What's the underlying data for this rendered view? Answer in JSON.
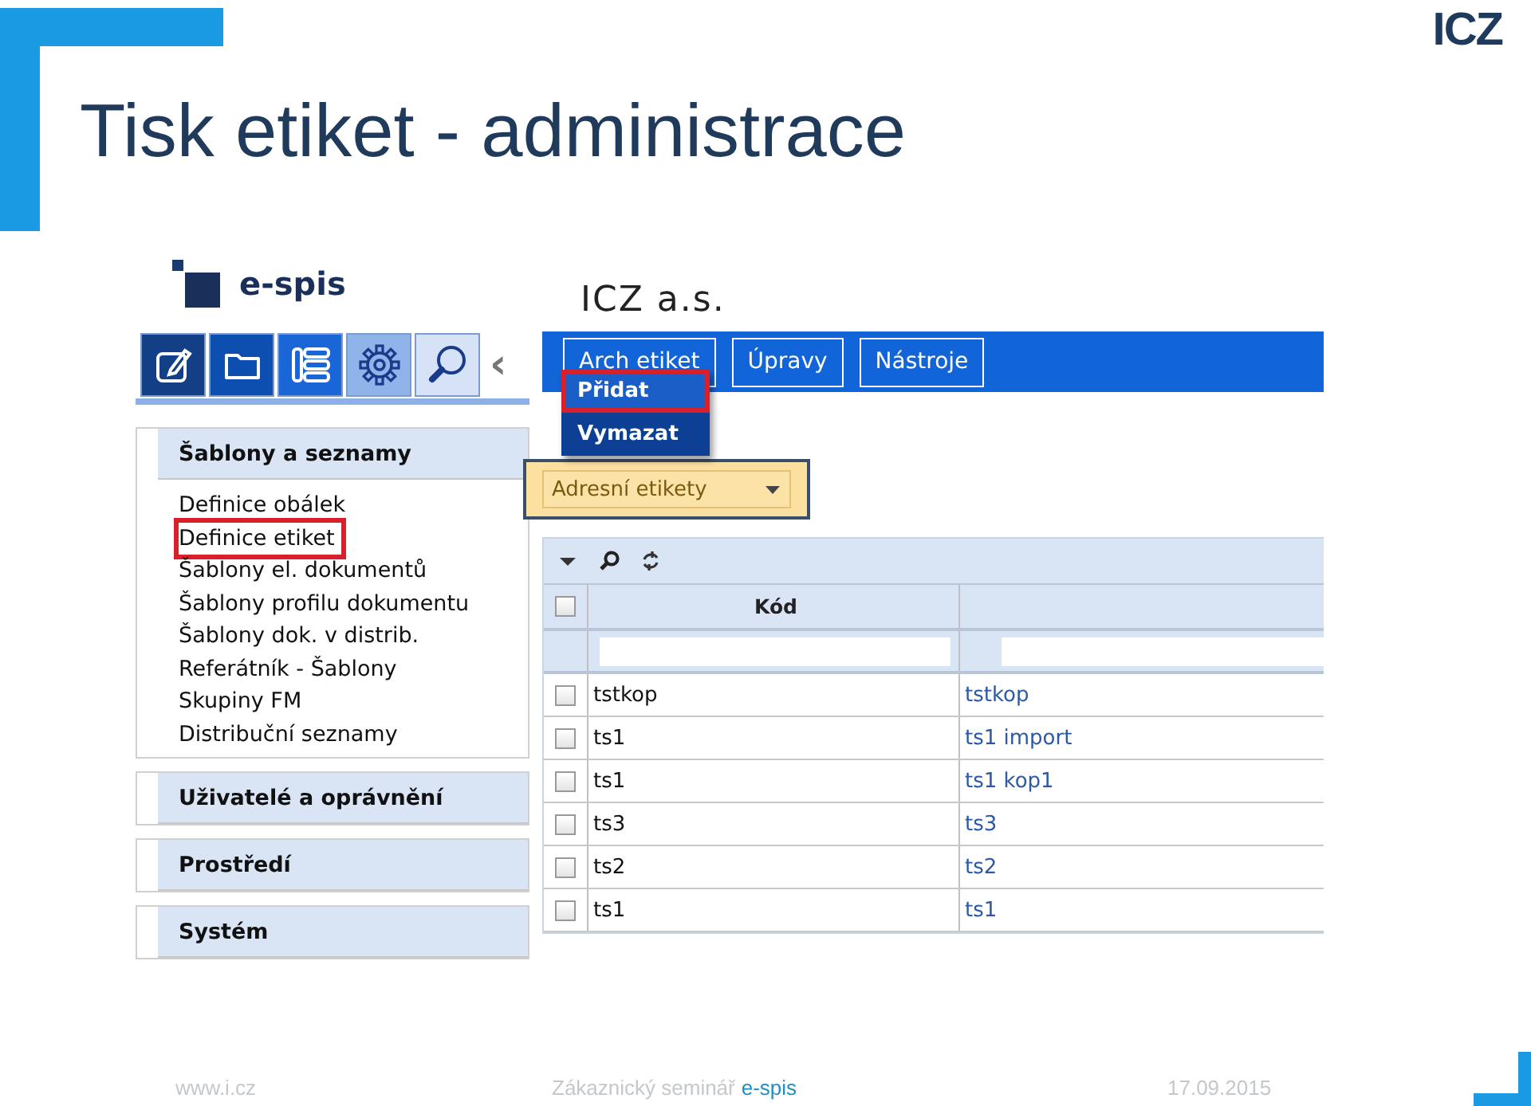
{
  "slide": {
    "title": "Tisk etiket - administrace",
    "logo": "ICZ"
  },
  "app": {
    "brand": "e-spis",
    "company": "ICZ a.s.",
    "nav_tabs": [
      {
        "kind": "edit",
        "color": "#123f86"
      },
      {
        "kind": "folder",
        "color": "#0d4fb0"
      },
      {
        "kind": "list",
        "color": "#1a66d6"
      },
      {
        "kind": "gear",
        "color": "#8fb4ea"
      },
      {
        "kind": "search",
        "color": "#d6e3f7"
      }
    ],
    "collapse": "‹",
    "sidebar": [
      {
        "title": "Šablony a seznamy",
        "items": [
          {
            "label": "Definice obálek",
            "marked": false
          },
          {
            "label": "Definice etiket",
            "marked": true
          },
          {
            "label": "Šablony el. dokumentů",
            "marked": false
          },
          {
            "label": "Šablony profilu dokumentu",
            "marked": false
          },
          {
            "label": "Šablony dok. v distrib.",
            "marked": false
          },
          {
            "label": "Referátník - Šablony",
            "marked": false
          },
          {
            "label": "Skupiny FM",
            "marked": false
          },
          {
            "label": "Distribuční seznamy",
            "marked": false
          }
        ]
      },
      {
        "title": "Uživatelé a oprávnění"
      },
      {
        "title": "Prostředí"
      },
      {
        "title": "Systém"
      }
    ],
    "menubar": [
      "Arch etiket",
      "Úpravy",
      "Nástroje"
    ],
    "menu": [
      {
        "label": "Přidat",
        "selected": true,
        "marked": true
      },
      {
        "label": "Vymazat",
        "selected": false,
        "marked": false
      }
    ],
    "select": {
      "value": "Adresní etikety",
      "marked": true
    },
    "grid": {
      "columns": [
        "Kód"
      ],
      "all_checked": false,
      "rows": [
        {
          "checked": false,
          "code": "tstkop",
          "column_2": "tstkop"
        },
        {
          "checked": false,
          "code": "ts1",
          "column_2": "ts1 import"
        },
        {
          "checked": false,
          "code": "ts1",
          "column_2": "ts1 kop1"
        },
        {
          "checked": false,
          "code": "ts3",
          "column_2": "ts3"
        },
        {
          "checked": false,
          "code": "ts2",
          "column_2": "ts2"
        },
        {
          "checked": false,
          "code": "ts1",
          "column_2": "ts1"
        }
      ]
    }
  },
  "footer": {
    "url": "www.i.cz",
    "event": "Zákaznický seminář",
    "product": "e-spis",
    "date": "17.09.2015"
  }
}
